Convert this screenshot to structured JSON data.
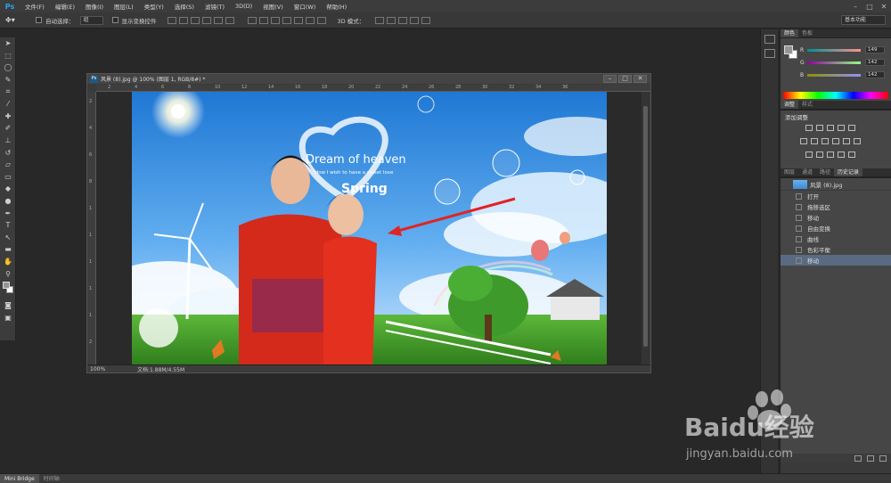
{
  "menubar": {
    "logo": "Ps",
    "items": [
      "文件(F)",
      "编辑(E)",
      "图像(I)",
      "图层(L)",
      "类型(Y)",
      "选择(S)",
      "滤镜(T)",
      "3D(D)",
      "视图(V)",
      "窗口(W)",
      "帮助(H)"
    ]
  },
  "optionsbar": {
    "auto_select_label": "自动选择：",
    "auto_select_value": "组",
    "show_transform_label": "显示变换控件",
    "mode_label": "3D 模式：",
    "workspace": "基本功能"
  },
  "document": {
    "title": "风景 (8).jpg @ 100% (图层 1, RGB/8#) *",
    "zoom": "100%",
    "info": "文档:1.88M/4.55M",
    "ruler_top": [
      "2",
      "4",
      "6",
      "8",
      "10",
      "12",
      "14",
      "16",
      "18",
      "20",
      "22",
      "24",
      "26",
      "28",
      "30",
      "32",
      "34",
      "36"
    ],
    "ruler_left": [
      "2",
      "4",
      "6",
      "8",
      "1",
      "1",
      "1",
      "1",
      "1",
      "2"
    ],
    "artwork_text": {
      "line1": "Dream of heaven",
      "line2": "How I wish to have a sweet love",
      "line3": "Spring"
    }
  },
  "color_panel": {
    "tabs": [
      "颜色",
      "色板"
    ],
    "channels": [
      {
        "label": "R",
        "value": "149",
        "color": "#e05050"
      },
      {
        "label": "G",
        "value": "142",
        "color": "#50c050"
      },
      {
        "label": "B",
        "value": "142",
        "color": "#5050e0"
      }
    ]
  },
  "adjustments_panel": {
    "tabs": [
      "调整",
      "样式"
    ],
    "title": "添加调整"
  },
  "history_panel": {
    "tabs": [
      "图层",
      "通道",
      "路径",
      "历史记录"
    ],
    "snapshot": "风景 (8).jpg",
    "items": [
      "打开",
      "拖移选区",
      "移动",
      "自由变换",
      "曲线",
      "色彩平衡",
      "移动"
    ]
  },
  "bottombar": {
    "tabs": [
      "Mini Bridge",
      "时间轴"
    ]
  },
  "watermark": {
    "brand": "Baidu经验",
    "url": "jingyan.baidu.com"
  }
}
